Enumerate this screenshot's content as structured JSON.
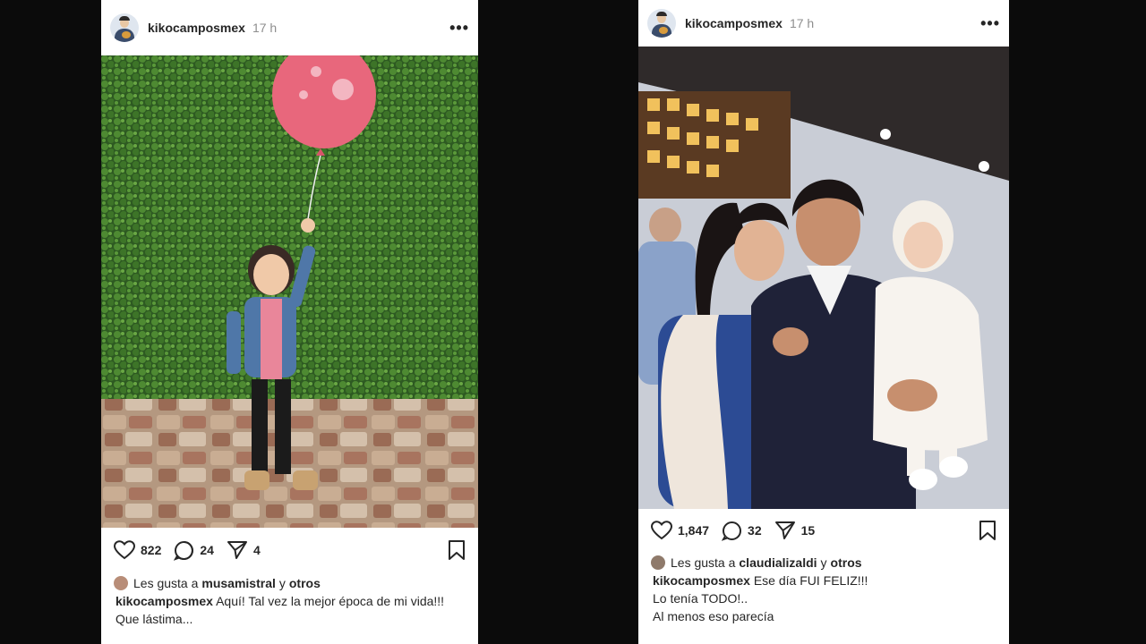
{
  "posts": [
    {
      "username": "kikocamposmex",
      "time": "17 h",
      "likes_count": "822",
      "comments_count": "24",
      "shares_count": "4",
      "liked_by_prefix": "Les gusta a",
      "liked_by_user": "musamistral",
      "liked_by_joiner": "y",
      "liked_by_others": "otros",
      "caption_lines": [
        "Aquí! Tal vez la mejor época de mi vida!!!",
        "Que lástima..."
      ],
      "photo_icon": "girl-with-balloon-photo"
    },
    {
      "username": "kikocamposmex",
      "time": "17 h",
      "likes_count": "1,847",
      "comments_count": "32",
      "shares_count": "15",
      "liked_by_prefix": "Les gusta a",
      "liked_by_user": "claudializaldi",
      "liked_by_joiner": "y",
      "liked_by_others": "otros",
      "caption_lines": [
        "Ese día FUI FELIZ!!!",
        "Lo tenía TODO!..",
        "Al menos eso parecía"
      ],
      "photo_icon": "family-baptism-photo"
    }
  ],
  "icons": {
    "more": "more-options-icon",
    "like": "heart-icon",
    "comment": "comment-icon",
    "share": "send-icon",
    "save": "bookmark-icon"
  },
  "colors": {
    "background": "#0b0b0b",
    "card": "#ffffff",
    "text": "#262626",
    "muted": "#8e8e8e"
  }
}
